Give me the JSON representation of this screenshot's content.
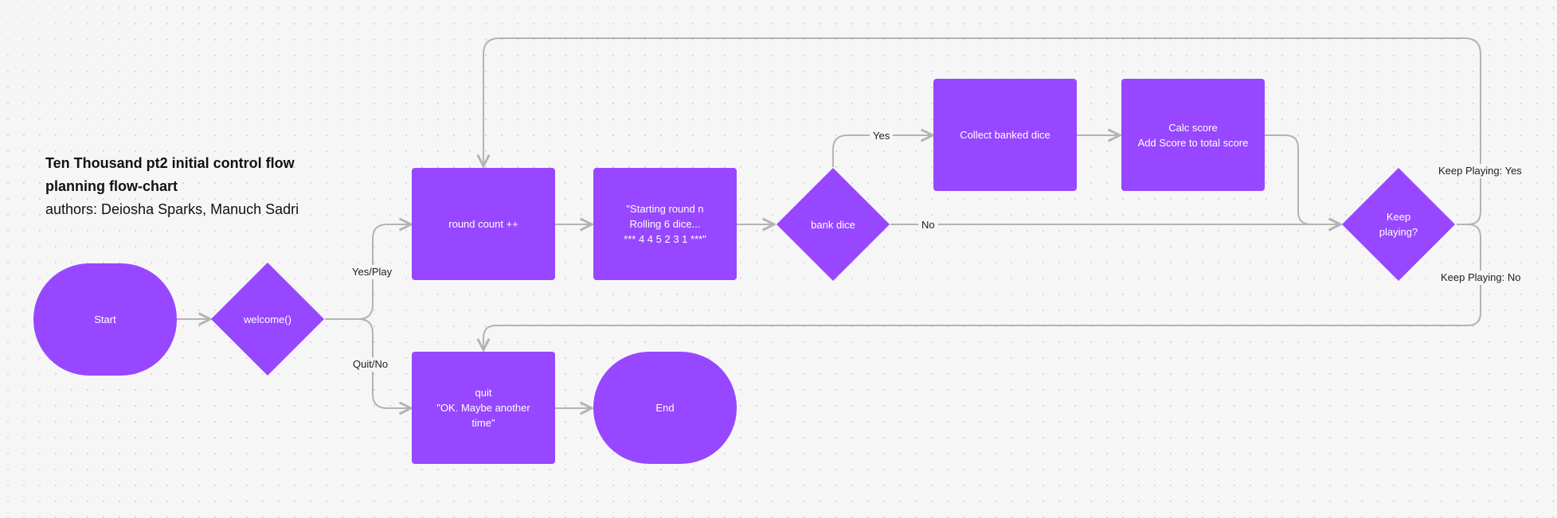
{
  "title": {
    "line1": "Ten Thousand pt2 initial control flow",
    "line2": "planning flow-chart",
    "authors": "authors: Deiosha Sparks, Manuch Sadri"
  },
  "colors": {
    "node_fill": "#9747ff",
    "connector": "#b3b3b3",
    "background": "#f6f6f7"
  },
  "nodes": {
    "start": "Start",
    "welcome": "welcome()",
    "round_count": "round count ++",
    "starting_round": "\"Starting round n\nRolling 6 dice...\n*** 4 4 5 2 3 1 ***\"",
    "bank_dice": "bank dice",
    "collect_banked": "Collect banked dice",
    "calc_score": "Calc score\nAdd Score to total score",
    "keep_playing": "Keep\nplaying?",
    "quit": "quit\n\"OK. Maybe another\ntime\"",
    "end": "End"
  },
  "edge_labels": {
    "yes_play": "Yes/Play",
    "quit_no": "Quit/No",
    "yes": "Yes",
    "no": "No",
    "keep_playing_yes": "Keep Playing: Yes",
    "keep_playing_no": "Keep Playing: No"
  }
}
